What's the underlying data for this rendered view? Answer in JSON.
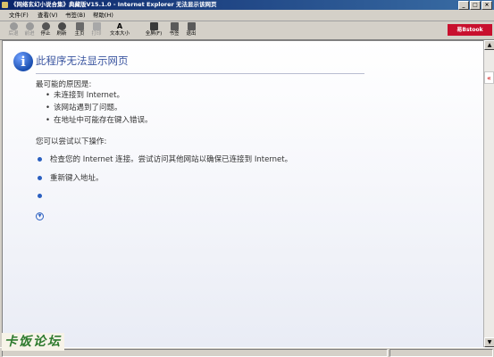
{
  "window": {
    "title": "《网络玄幻小说合集》典藏版V15.1.0 - Internet Explorer 无法显示该网页"
  },
  "menu": [
    "文件(F)",
    "查看(V)",
    "书签(B)",
    "帮助(H)"
  ],
  "toolbar": {
    "buttons": [
      {
        "label": "后退",
        "enabled": false,
        "icon": "back-arrow-icon"
      },
      {
        "label": "前进",
        "enabled": false,
        "icon": "forward-arrow-icon"
      },
      {
        "label": "停止",
        "enabled": true,
        "icon": "stop-icon"
      },
      {
        "label": "刷新",
        "enabled": true,
        "icon": "refresh-icon"
      },
      {
        "label": "主页",
        "enabled": true,
        "icon": "home-icon"
      },
      {
        "label": "打印",
        "enabled": false,
        "icon": "print-icon"
      },
      {
        "label": "文本大小",
        "enabled": true,
        "icon": "text-size-icon"
      },
      {
        "label": "全屏(F)",
        "enabled": true,
        "icon": "fullscreen-icon"
      },
      {
        "label": "书签",
        "enabled": true,
        "icon": "bookmark-icon"
      },
      {
        "label": "退出",
        "enabled": true,
        "icon": "exit-icon"
      }
    ],
    "brand": "易Bstook"
  },
  "page": {
    "heading": "此程序无法显示网页",
    "causes_title": "最可能的原因是:",
    "causes": [
      "未连接到 Internet。",
      "该网站遇到了问题。",
      "在地址中可能存在键入错误。"
    ],
    "actions_title": "您可以尝试以下操作:",
    "actions": [
      "检查您的 Internet 连接。尝试访问其他网站以确保已连接到 Internet。",
      "重新键入地址。"
    ]
  },
  "watermark": "卡饭论坛",
  "colors": {
    "heading": "#3a55a0",
    "brand_bg": "#c8102e",
    "titlebar": "#0a246a",
    "watermark": "#2d7a2d"
  }
}
